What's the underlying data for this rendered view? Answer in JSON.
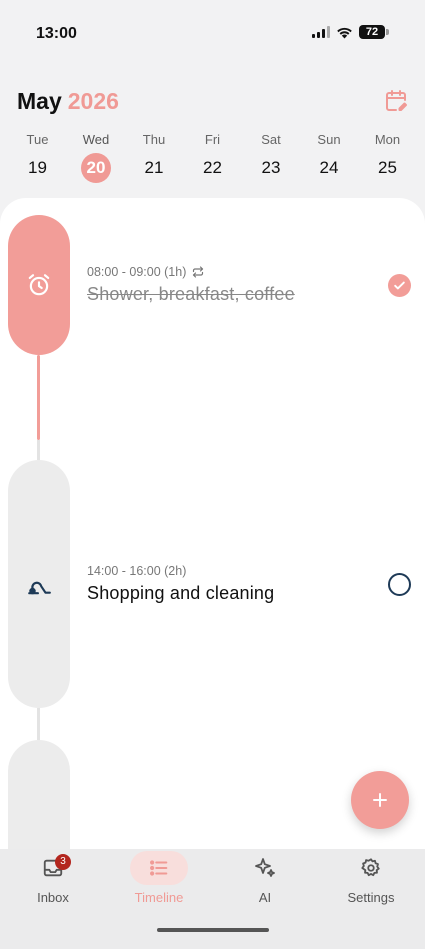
{
  "status_bar": {
    "time": "13:00",
    "battery": "72"
  },
  "header": {
    "month": "May",
    "year": "2026"
  },
  "week": [
    {
      "name": "Tue",
      "num": "19"
    },
    {
      "name": "Wed",
      "num": "20",
      "selected": true
    },
    {
      "name": "Thu",
      "num": "21"
    },
    {
      "name": "Fri",
      "num": "22"
    },
    {
      "name": "Sat",
      "num": "23"
    },
    {
      "name": "Sun",
      "num": "24"
    },
    {
      "name": "Mon",
      "num": "25"
    }
  ],
  "tasks": [
    {
      "time": "08:00 - 09:00 (1h)",
      "title": "Shower, breakfast, coffee",
      "done": true,
      "icon": "alarm-clock-icon",
      "repeat": true
    },
    {
      "time": "14:00 - 16:00 (2h)",
      "title": "Shopping and cleaning",
      "done": false,
      "icon": "vacuum-cleaner-icon"
    }
  ],
  "nav": [
    {
      "label": "Inbox",
      "icon": "inbox-icon",
      "badge": "3"
    },
    {
      "label": "Timeline",
      "icon": "list-icon",
      "active": true
    },
    {
      "label": "AI",
      "icon": "sparkles-icon"
    },
    {
      "label": "Settings",
      "icon": "gear-icon"
    }
  ],
  "colors": {
    "accent": "#f09a95",
    "pill_inactive": "#ececec",
    "check_open": "#1e3a57",
    "badge": "#b3261e"
  }
}
